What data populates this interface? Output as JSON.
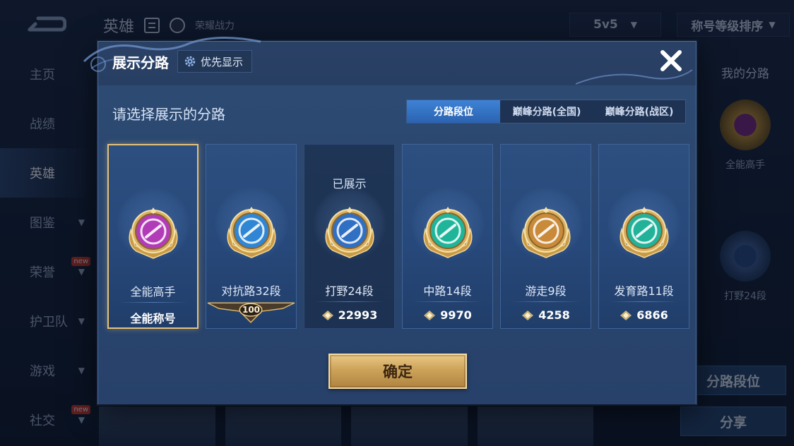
{
  "background": {
    "top_title": "英雄",
    "top_subtitle": "荣耀战力",
    "mode_select": "5v5",
    "sort_select": "称号等级排序",
    "sidebar": [
      {
        "label": "主页",
        "active": false,
        "chevron": false,
        "badge": ""
      },
      {
        "label": "战绩",
        "active": false,
        "chevron": false,
        "badge": ""
      },
      {
        "label": "英雄",
        "active": true,
        "chevron": false,
        "badge": ""
      },
      {
        "label": "图鉴",
        "active": false,
        "chevron": true,
        "badge": ""
      },
      {
        "label": "荣誉",
        "active": false,
        "chevron": true,
        "badge": "new"
      },
      {
        "label": "护卫队",
        "active": false,
        "chevron": true,
        "badge": ""
      },
      {
        "label": "游戏",
        "active": false,
        "chevron": true,
        "badge": ""
      },
      {
        "label": "社交",
        "active": false,
        "chevron": true,
        "badge": "new"
      }
    ],
    "right_panel": {
      "title": "我的分路",
      "primary_label": "全能高手",
      "secondary_label": "打野24段",
      "button_lane_rank": "分路段位",
      "button_share": "分享"
    }
  },
  "modal": {
    "title": "展示分路",
    "priority_button": "优先显示",
    "prompt": "请选择展示的分路",
    "tabs": [
      {
        "label": "分路段位",
        "active": true
      },
      {
        "label": "巅峰分路(全国)",
        "active": false
      },
      {
        "label": "巅峰分路(战区)",
        "active": false
      }
    ],
    "cards": [
      {
        "label": "全能高手",
        "value": "全能称号",
        "shown": "",
        "emblem_color": "#b23cb8",
        "selected": true,
        "dark": false,
        "value_type": "text"
      },
      {
        "label": "对抗路32段",
        "value": "100",
        "shown": "",
        "emblem_color": "#2f86d4",
        "selected": false,
        "dark": false,
        "value_type": "badge"
      },
      {
        "label": "打野24段",
        "value": "22993",
        "shown": "已展示",
        "emblem_color": "#2f6fc4",
        "selected": false,
        "dark": true,
        "value_type": "points"
      },
      {
        "label": "中路14段",
        "value": "9970",
        "shown": "",
        "emblem_color": "#1fb59a",
        "selected": false,
        "dark": false,
        "value_type": "points"
      },
      {
        "label": "游走9段",
        "value": "4258",
        "shown": "",
        "emblem_color": "#c98a3a",
        "selected": false,
        "dark": false,
        "value_type": "points"
      },
      {
        "label": "发育路11段",
        "value": "6866",
        "shown": "",
        "emblem_color": "#22b29a",
        "selected": false,
        "dark": false,
        "value_type": "points"
      }
    ],
    "confirm_button": "确定"
  },
  "colors": {
    "accent_gold": "#e5c27a",
    "tab_active": "#3e82d6",
    "panel": "#27416a"
  }
}
